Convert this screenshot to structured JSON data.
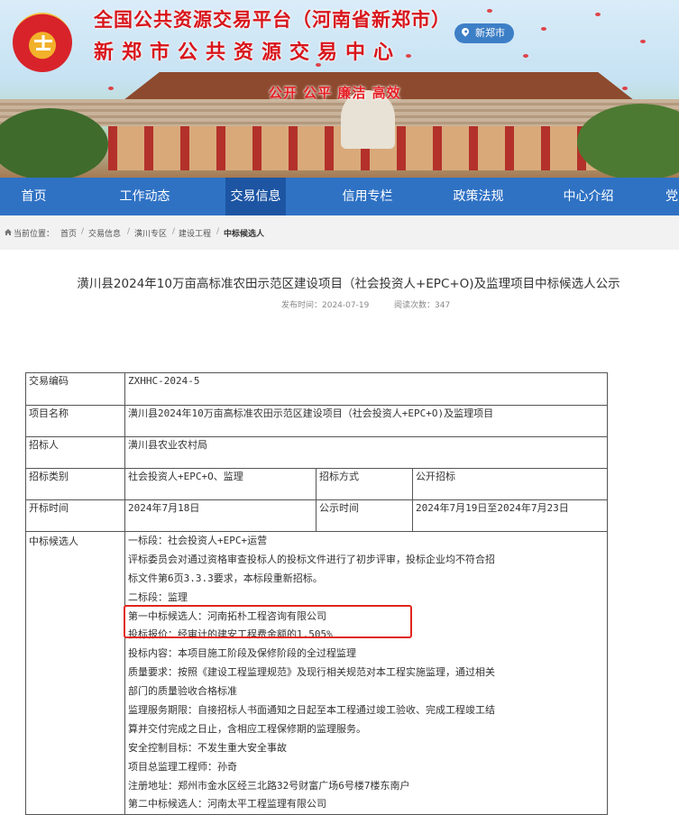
{
  "header": {
    "title_line1": "全国公共资源交易平台（河南省新郑市）",
    "title_line2": "新郑市公共资源交易中心",
    "location": "新郑市",
    "slogan": "公开  公平  廉洁  高效"
  },
  "nav": {
    "items": [
      {
        "label": "首页"
      },
      {
        "label": "工作动态"
      },
      {
        "label": "交易信息",
        "active": true
      },
      {
        "label": "信用专栏"
      },
      {
        "label": "政策法规"
      },
      {
        "label": "中心介绍"
      },
      {
        "label": "党"
      }
    ]
  },
  "breadcrumb": {
    "prefix": "当前位置：",
    "items": [
      "首页",
      "交易信息",
      "潢川专区",
      "建设工程",
      "中标候选人"
    ]
  },
  "article": {
    "title": "潢川县2024年10万亩高标准农田示范区建设项目（社会投资人+EPC+O)及监理项目中标候选人公示",
    "publish_label": "发布时间：2024-07-19",
    "views_label": "阅读次数：347"
  },
  "table": {
    "trade_no_label": "交易编码",
    "trade_no": "ZXHHC-2024-5",
    "project_name_label": "项目名称",
    "project_name": "潢川县2024年10万亩高标准农田示范区建设项目（社会投资人+EPC+O)及监理项目",
    "tenderer_label": "招标人",
    "tenderer": "潢川县农业农村局",
    "tender_type_label": "招标类别",
    "tender_type": "社会投资人+EPC+O、监理",
    "tender_method_label": "招标方式",
    "tender_method": "公开招标",
    "open_time_label": "开标时间",
    "open_time": "2024年7月18日",
    "publicity_label": "公示时间",
    "publicity_time": "2024年7月19日至2024年7月23日",
    "candidate_label": "中标候选人",
    "candidate_lines": [
      "一标段：社会投资人+EPC+运营",
      "评标委员会对通过资格审查投标人的投标文件进行了初步评审，投标企业均不符合招",
      "标文件第6页3.3.3要求，本标段重新招标。",
      "二标段：监理",
      "第一中标候选人：河南拓朴工程咨询有限公司",
      "投标报价：经审计的建安工程费金额的1.505%",
      "投标内容：本项目施工阶段及保修阶段的全过程监理",
      "质量要求：按照《建设工程监理规范》及现行相关规范对本工程实施监理，通过相关",
      "部门的质量验收合格标准",
      "监理服务期限：自接招标人书面通知之日起至本工程通过竣工验收、完成工程竣工结",
      "算并交付完成之日止，含相应工程保修期的监理服务。",
      "安全控制目标：不发生重大安全事故",
      "项目总监理工程师：孙奇",
      "注册地址：郑州市金水区经三北路32号财富广场6号楼7楼东南户",
      "第二中标候选人：河南太平工程监理有限公司"
    ]
  }
}
